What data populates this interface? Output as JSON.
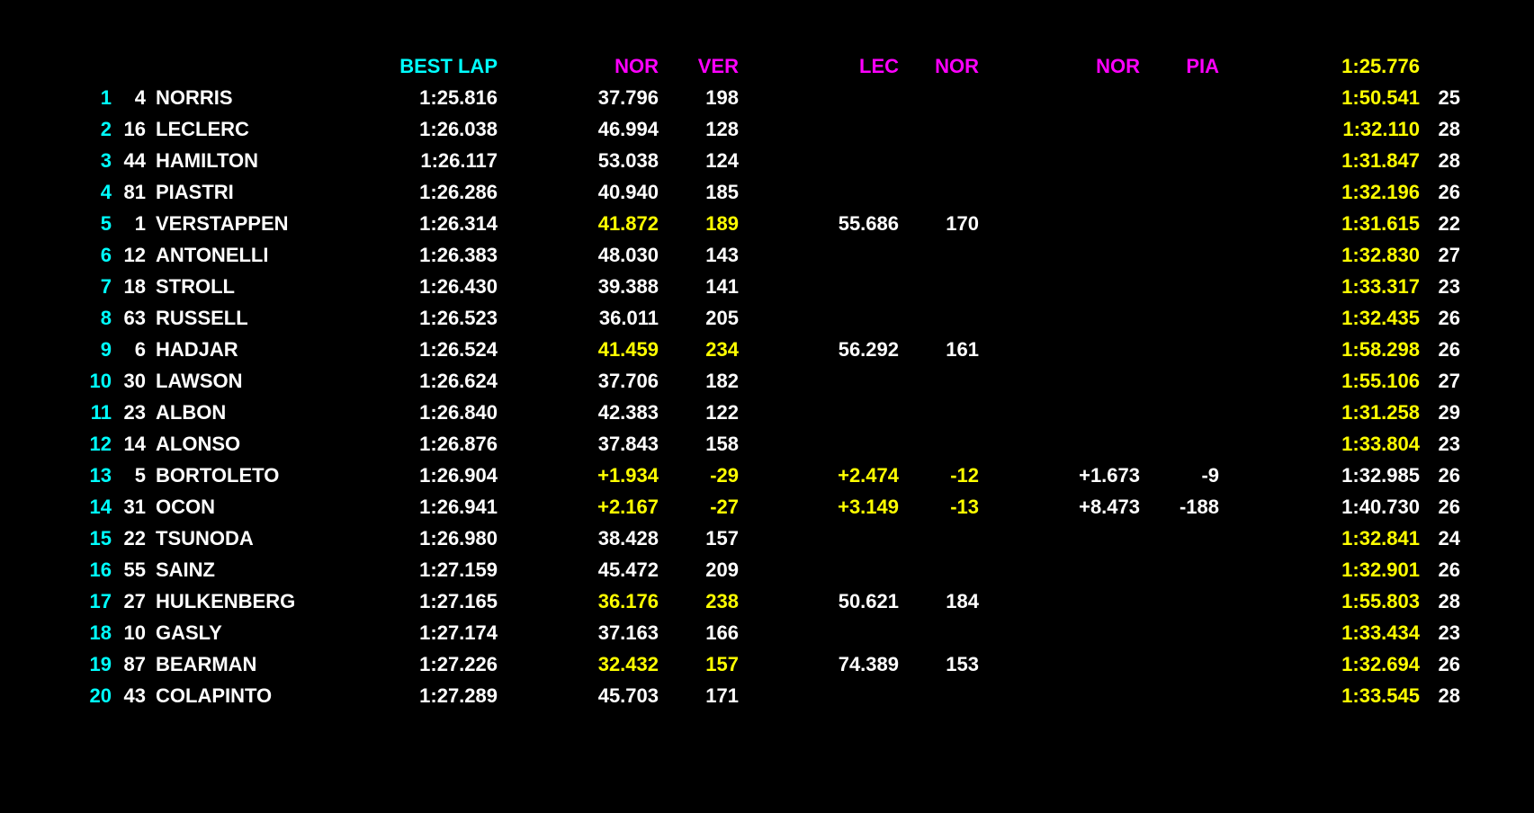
{
  "colors": {
    "background": "#000000",
    "white": "#ffffff",
    "yellow": "#ffff00",
    "cyan": "#00ffff",
    "magenta": "#ff00ff"
  },
  "header": {
    "best_lap": "BEST LAP",
    "col1": "NOR",
    "col2": "VER",
    "col3": "LEC",
    "col4": "NOR",
    "col5": "NOR",
    "col6": "PIA",
    "overall_best": "1:25.776"
  },
  "rows": [
    {
      "pos": "1",
      "num": "4",
      "name": "NORRIS",
      "best": "1:25.816",
      "s1": "37.796",
      "s2": "198",
      "s12_color": "white",
      "s3": "",
      "s4": "",
      "s34_color": "white",
      "s5": "",
      "s6": "",
      "last": "1:50.541",
      "last_color": "yellow",
      "laps": "25"
    },
    {
      "pos": "2",
      "num": "16",
      "name": "LECLERC",
      "best": "1:26.038",
      "s1": "46.994",
      "s2": "128",
      "s12_color": "white",
      "s3": "",
      "s4": "",
      "s34_color": "white",
      "s5": "",
      "s6": "",
      "last": "1:32.110",
      "last_color": "yellow",
      "laps": "28"
    },
    {
      "pos": "3",
      "num": "44",
      "name": "HAMILTON",
      "best": "1:26.117",
      "s1": "53.038",
      "s2": "124",
      "s12_color": "white",
      "s3": "",
      "s4": "",
      "s34_color": "white",
      "s5": "",
      "s6": "",
      "last": "1:31.847",
      "last_color": "yellow",
      "laps": "28"
    },
    {
      "pos": "4",
      "num": "81",
      "name": "PIASTRI",
      "best": "1:26.286",
      "s1": "40.940",
      "s2": "185",
      "s12_color": "white",
      "s3": "",
      "s4": "",
      "s34_color": "white",
      "s5": "",
      "s6": "",
      "last": "1:32.196",
      "last_color": "yellow",
      "laps": "26"
    },
    {
      "pos": "5",
      "num": "1",
      "name": "VERSTAPPEN",
      "best": "1:26.314",
      "s1": "41.872",
      "s2": "189",
      "s12_color": "yellow",
      "s3": "55.686",
      "s4": "170",
      "s34_color": "white",
      "s5": "",
      "s6": "",
      "last": "1:31.615",
      "last_color": "yellow",
      "laps": "22"
    },
    {
      "pos": "6",
      "num": "12",
      "name": "ANTONELLI",
      "best": "1:26.383",
      "s1": "48.030",
      "s2": "143",
      "s12_color": "white",
      "s3": "",
      "s4": "",
      "s34_color": "white",
      "s5": "",
      "s6": "",
      "last": "1:32.830",
      "last_color": "yellow",
      "laps": "27"
    },
    {
      "pos": "7",
      "num": "18",
      "name": "STROLL",
      "best": "1:26.430",
      "s1": "39.388",
      "s2": "141",
      "s12_color": "white",
      "s3": "",
      "s4": "",
      "s34_color": "white",
      "s5": "",
      "s6": "",
      "last": "1:33.317",
      "last_color": "yellow",
      "laps": "23"
    },
    {
      "pos": "8",
      "num": "63",
      "name": "RUSSELL",
      "best": "1:26.523",
      "s1": "36.011",
      "s2": "205",
      "s12_color": "white",
      "s3": "",
      "s4": "",
      "s34_color": "white",
      "s5": "",
      "s6": "",
      "last": "1:32.435",
      "last_color": "yellow",
      "laps": "26"
    },
    {
      "pos": "9",
      "num": "6",
      "name": "HADJAR",
      "best": "1:26.524",
      "s1": "41.459",
      "s2": "234",
      "s12_color": "yellow",
      "s3": "56.292",
      "s4": "161",
      "s34_color": "white",
      "s5": "",
      "s6": "",
      "last": "1:58.298",
      "last_color": "yellow",
      "laps": "26"
    },
    {
      "pos": "10",
      "num": "30",
      "name": "LAWSON",
      "best": "1:26.624",
      "s1": "37.706",
      "s2": "182",
      "s12_color": "white",
      "s3": "",
      "s4": "",
      "s34_color": "white",
      "s5": "",
      "s6": "",
      "last": "1:55.106",
      "last_color": "yellow",
      "laps": "27"
    },
    {
      "pos": "11",
      "num": "23",
      "name": "ALBON",
      "best": "1:26.840",
      "s1": "42.383",
      "s2": "122",
      "s12_color": "white",
      "s3": "",
      "s4": "",
      "s34_color": "white",
      "s5": "",
      "s6": "",
      "last": "1:31.258",
      "last_color": "yellow",
      "laps": "29"
    },
    {
      "pos": "12",
      "num": "14",
      "name": "ALONSO",
      "best": "1:26.876",
      "s1": "37.843",
      "s2": "158",
      "s12_color": "white",
      "s3": "",
      "s4": "",
      "s34_color": "white",
      "s5": "",
      "s6": "",
      "last": "1:33.804",
      "last_color": "yellow",
      "laps": "23"
    },
    {
      "pos": "13",
      "num": "5",
      "name": "BORTOLETO",
      "best": "1:26.904",
      "s1": "+1.934",
      "s2": "-29",
      "s12_color": "yellow",
      "s3": "+2.474",
      "s4": "-12",
      "s34_color": "yellow",
      "s5": "+1.673",
      "s6": "-9",
      "last": "1:32.985",
      "last_color": "white",
      "laps": "26"
    },
    {
      "pos": "14",
      "num": "31",
      "name": "OCON",
      "best": "1:26.941",
      "s1": "+2.167",
      "s2": "-27",
      "s12_color": "yellow",
      "s3": "+3.149",
      "s4": "-13",
      "s34_color": "yellow",
      "s5": "+8.473",
      "s6": "-188",
      "last": "1:40.730",
      "last_color": "white",
      "laps": "26"
    },
    {
      "pos": "15",
      "num": "22",
      "name": "TSUNODA",
      "best": "1:26.980",
      "s1": "38.428",
      "s2": "157",
      "s12_color": "white",
      "s3": "",
      "s4": "",
      "s34_color": "white",
      "s5": "",
      "s6": "",
      "last": "1:32.841",
      "last_color": "yellow",
      "laps": "24"
    },
    {
      "pos": "16",
      "num": "55",
      "name": "SAINZ",
      "best": "1:27.159",
      "s1": "45.472",
      "s2": "209",
      "s12_color": "white",
      "s3": "",
      "s4": "",
      "s34_color": "white",
      "s5": "",
      "s6": "",
      "last": "1:32.901",
      "last_color": "yellow",
      "laps": "26"
    },
    {
      "pos": "17",
      "num": "27",
      "name": "HULKENBERG",
      "best": "1:27.165",
      "s1": "36.176",
      "s2": "238",
      "s12_color": "yellow",
      "s3": "50.621",
      "s4": "184",
      "s34_color": "white",
      "s5": "",
      "s6": "",
      "last": "1:55.803",
      "last_color": "yellow",
      "laps": "28"
    },
    {
      "pos": "18",
      "num": "10",
      "name": "GASLY",
      "best": "1:27.174",
      "s1": "37.163",
      "s2": "166",
      "s12_color": "white",
      "s3": "",
      "s4": "",
      "s34_color": "white",
      "s5": "",
      "s6": "",
      "last": "1:33.434",
      "last_color": "yellow",
      "laps": "23"
    },
    {
      "pos": "19",
      "num": "87",
      "name": "BEARMAN",
      "best": "1:27.226",
      "s1": "32.432",
      "s2": "157",
      "s12_color": "yellow",
      "s3": "74.389",
      "s4": "153",
      "s34_color": "white",
      "s5": "",
      "s6": "",
      "last": "1:32.694",
      "last_color": "yellow",
      "laps": "26"
    },
    {
      "pos": "20",
      "num": "43",
      "name": "COLAPINTO",
      "best": "1:27.289",
      "s1": "45.703",
      "s2": "171",
      "s12_color": "white",
      "s3": "",
      "s4": "",
      "s34_color": "white",
      "s5": "",
      "s6": "",
      "last": "1:33.545",
      "last_color": "yellow",
      "laps": "28"
    }
  ]
}
